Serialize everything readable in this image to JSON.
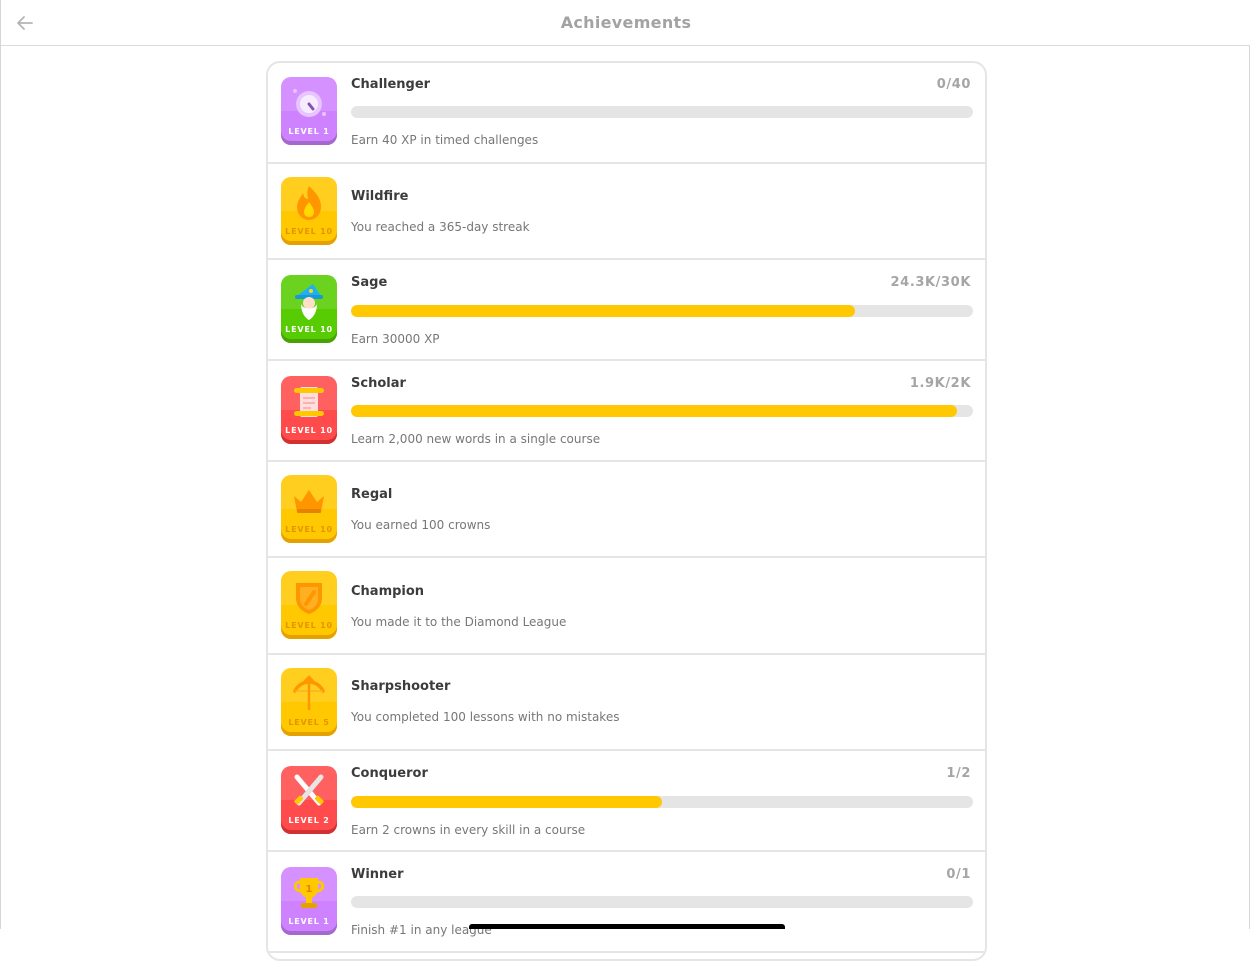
{
  "header": {
    "title": "Achievements",
    "back_icon": "arrow-left-icon"
  },
  "achievements": [
    {
      "title": "Challenger",
      "level": "LEVEL 1",
      "progress": "0/40",
      "fraction": 0.0,
      "description": "Earn 40 XP in timed challenges",
      "badge_color": "#ce82ff",
      "badge_dark": "#a568cc",
      "level_color": "#ffffff",
      "icon": "stopwatch-icon"
    },
    {
      "title": "Wildfire",
      "level": "LEVEL 10",
      "progress": "",
      "description": "You reached a 365-day streak",
      "badge_color": "#ffc800",
      "badge_dark": "#e5a100",
      "level_color": "#e59400",
      "icon": "flame-icon"
    },
    {
      "title": "Sage",
      "level": "LEVEL 10",
      "progress": "24.3K/30K",
      "fraction": 0.81,
      "description": "Earn 30000 XP",
      "badge_color": "#58cc02",
      "badge_dark": "#46a302",
      "level_color": "#ffffff",
      "icon": "wizard-icon"
    },
    {
      "title": "Scholar",
      "level": "LEVEL 10",
      "progress": "1.9K/2K",
      "fraction": 0.975,
      "description": "Learn 2,000 new words in a single course",
      "badge_color": "#ff4b4b",
      "badge_dark": "#d33131",
      "level_color": "#ffffff",
      "icon": "scroll-icon"
    },
    {
      "title": "Regal",
      "level": "LEVEL 10",
      "progress": "",
      "description": "You earned 100 crowns",
      "badge_color": "#ffc800",
      "badge_dark": "#e5a100",
      "level_color": "#e59400",
      "icon": "crown-icon"
    },
    {
      "title": "Champion",
      "level": "LEVEL 10",
      "progress": "",
      "description": "You made it to the Diamond League",
      "badge_color": "#ffc800",
      "badge_dark": "#e5a100",
      "level_color": "#e59400",
      "icon": "shield-icon"
    },
    {
      "title": "Sharpshooter",
      "level": "LEVEL 5",
      "progress": "",
      "description": "You completed 100 lessons with no mistakes",
      "badge_color": "#ffc800",
      "badge_dark": "#e5a100",
      "level_color": "#e59400",
      "icon": "bow-icon"
    },
    {
      "title": "Conqueror",
      "level": "LEVEL 2",
      "progress": "1/2",
      "fraction": 0.5,
      "description": "Earn 2 crowns in every skill in a course",
      "badge_color": "#ff4b4b",
      "badge_dark": "#d33131",
      "level_color": "#ffffff",
      "icon": "swords-icon"
    },
    {
      "title": "Winner",
      "level": "LEVEL 1",
      "progress": "0/1",
      "fraction": 0.0,
      "description": "Finish #1 in any league",
      "badge_color": "#ce82ff",
      "badge_dark": "#a568cc",
      "level_color": "#ffffff",
      "icon": "trophy-icon"
    }
  ]
}
